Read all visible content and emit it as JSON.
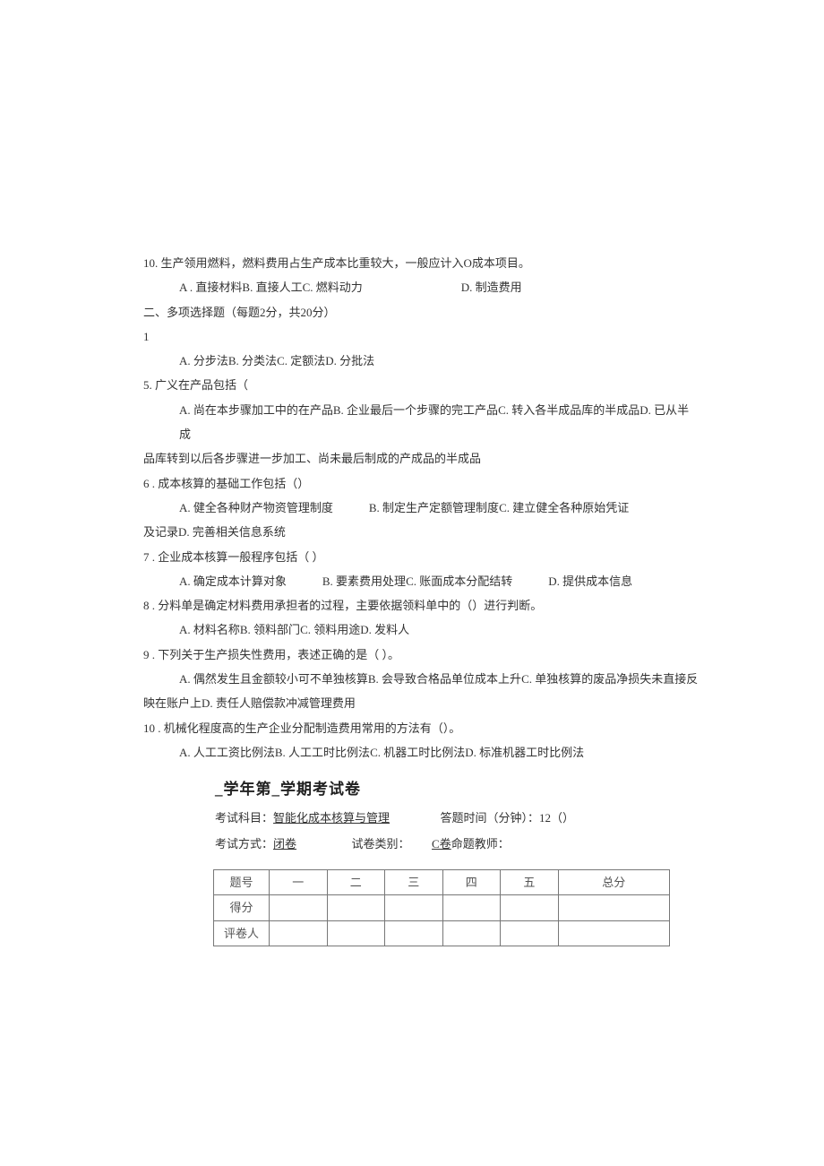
{
  "q10": {
    "text": "10. 生产领用燃料，燃料费用占生产成本比重较大，一般应计入O成本项目。",
    "a": "A . 直接材料",
    "b": "B. 直接人工",
    "c": "C. 燃料动力",
    "d": "D. 制造费用"
  },
  "section2": "二、多项选择题（每题2分，共20分）",
  "q1_num": "1",
  "q_after1": {
    "a": "A. 分步法",
    "b": "B. 分类法",
    "c": "C. 定额法",
    "d": "D. 分批法"
  },
  "q5": {
    "text": "5. 广义在产品包括（",
    "a": "A. 尚在本步骤加工中的在产品",
    "b": "B. 企业最后一个步骤的完工产品",
    "c": "C. 转入各半成品库的半成品",
    "d": "D. 已从半成",
    "cont": "品库转到以后各步骤进一步加工、尚未最后制成的产成品的半成品"
  },
  "q6": {
    "num": "6",
    "text": " . 成本核算的基础工作包括（）",
    "a": "A. 健全各种财产物资管理制度",
    "b": "B. 制定生产定额管理制度",
    "c": "C. 建立健全各种原始凭证",
    "cont": "及记录",
    "d": "D. 完善相关信息系统"
  },
  "q7": {
    "num": "7",
    "text": " . 企业成本核算一般程序包括（    ）",
    "a": "A. 确定成本计算对象",
    "b": "B. 要素费用处理",
    "c": "C. 账面成本分配结转",
    "d": "D. 提供成本信息"
  },
  "q8": {
    "num": "8",
    "text": " . 分料单是确定材料费用承担者的过程，主要依据领料单中的（）进行判断。",
    "a": "A. 材料名称",
    "b": "B. 领料部门",
    "c": "C. 领料用途",
    "d": "D. 发料人"
  },
  "q9": {
    "num": "9",
    "text": " . 下列关于生产损失性费用，表述正确的是（       ）。",
    "a": "A. 偶然发生且金额较小可不单独核算",
    "b": "B. 会导致合格品单位成本上升",
    "c": "C. 单独核算的废品净损失未直接反",
    "cont": "映在账户上",
    "d": "D. 责任人赔偿款冲减管理费用"
  },
  "q10b": {
    "num": "10",
    "text": " . 机械化程度高的生产企业分配制造费用常用的方法有（）。",
    "a": "A. 人工工资比例法",
    "b": "B. 人工工时比例法",
    "c": "C. 机器工时比例法",
    "d": "D. 标准机器工时比例法"
  },
  "title": "_学年第_学期考试卷",
  "info": {
    "subject_label": "考试科目：",
    "subject": "智能化成本核算与管理",
    "time_label": "答题时间（分钟）：12（）",
    "mode_label": "考试方式：",
    "mode": "闭卷",
    "paper_label": "试卷类别：",
    "paper": "C卷",
    "teacher": "命题教师："
  },
  "table": {
    "h0": "题号",
    "h1": "一",
    "h2": "二",
    "h3": "三",
    "h4": "四",
    "h5": "五",
    "h6": "总分",
    "r1": "得分",
    "r2": "评卷人"
  }
}
